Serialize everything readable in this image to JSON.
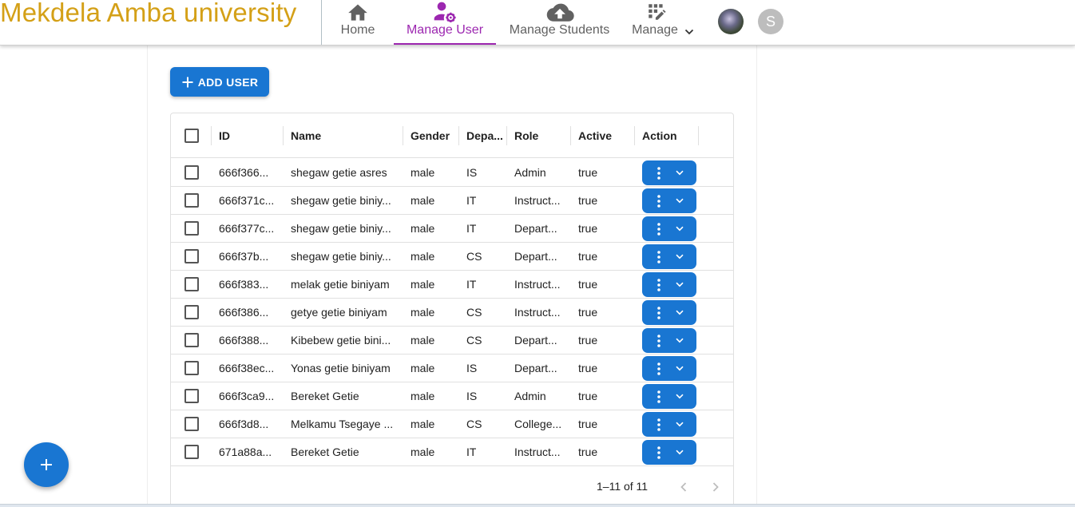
{
  "header": {
    "brand": "Mekdela Amba university",
    "nav": [
      {
        "label": "Home",
        "icon": "home-icon"
      },
      {
        "label": "Manage User",
        "icon": "manage-accounts-icon",
        "active": true
      },
      {
        "label": "Manage Students",
        "icon": "cloud-upload-icon"
      },
      {
        "label": "Manage",
        "icon": "edit-grid-icon"
      }
    ],
    "avatar_letter": "S"
  },
  "toolbar": {
    "add_user_label": "ADD USER"
  },
  "table": {
    "columns": [
      "ID",
      "Name",
      "Gender",
      "Depa...",
      "Role",
      "Active",
      "Action"
    ],
    "rows": [
      {
        "id": "666f366...",
        "name": "shegaw getie asres",
        "gender": "male",
        "dept": "IS",
        "role": "Admin",
        "active": "true"
      },
      {
        "id": "666f371c...",
        "name": "shegaw getie biniy...",
        "gender": "male",
        "dept": "IT",
        "role": "Instruct...",
        "active": "true"
      },
      {
        "id": "666f377c...",
        "name": "shegaw getie biniy...",
        "gender": "male",
        "dept": "IT",
        "role": "Depart...",
        "active": "true"
      },
      {
        "id": "666f37b...",
        "name": "shegaw getie biniy...",
        "gender": "male",
        "dept": "CS",
        "role": "Depart...",
        "active": "true"
      },
      {
        "id": "666f383...",
        "name": "melak getie biniyam",
        "gender": "male",
        "dept": "IT",
        "role": "Instruct...",
        "active": "true"
      },
      {
        "id": "666f386...",
        "name": "getye getie biniyam",
        "gender": "male",
        "dept": "CS",
        "role": "Instruct...",
        "active": "true"
      },
      {
        "id": "666f388...",
        "name": "Kibebew getie bini...",
        "gender": "male",
        "dept": "CS",
        "role": "Depart...",
        "active": "true"
      },
      {
        "id": "666f38ec...",
        "name": "Yonas getie biniyam",
        "gender": "male",
        "dept": "IS",
        "role": "Depart...",
        "active": "true"
      },
      {
        "id": "666f3ca9...",
        "name": "Bereket Getie",
        "gender": "male",
        "dept": "IS",
        "role": "Admin",
        "active": "true"
      },
      {
        "id": "666f3d8...",
        "name": "Melkamu Tsegaye ...",
        "gender": "male",
        "dept": "CS",
        "role": "College...",
        "active": "true"
      },
      {
        "id": "671a88a...",
        "name": "Bereket Getie",
        "gender": "male",
        "dept": "IT",
        "role": "Instruct...",
        "active": "true"
      }
    ],
    "pagination": "1–11 of 11"
  },
  "colors": {
    "brand": "#d4a017",
    "accent": "#9c27b0",
    "primary": "#1976d2"
  }
}
